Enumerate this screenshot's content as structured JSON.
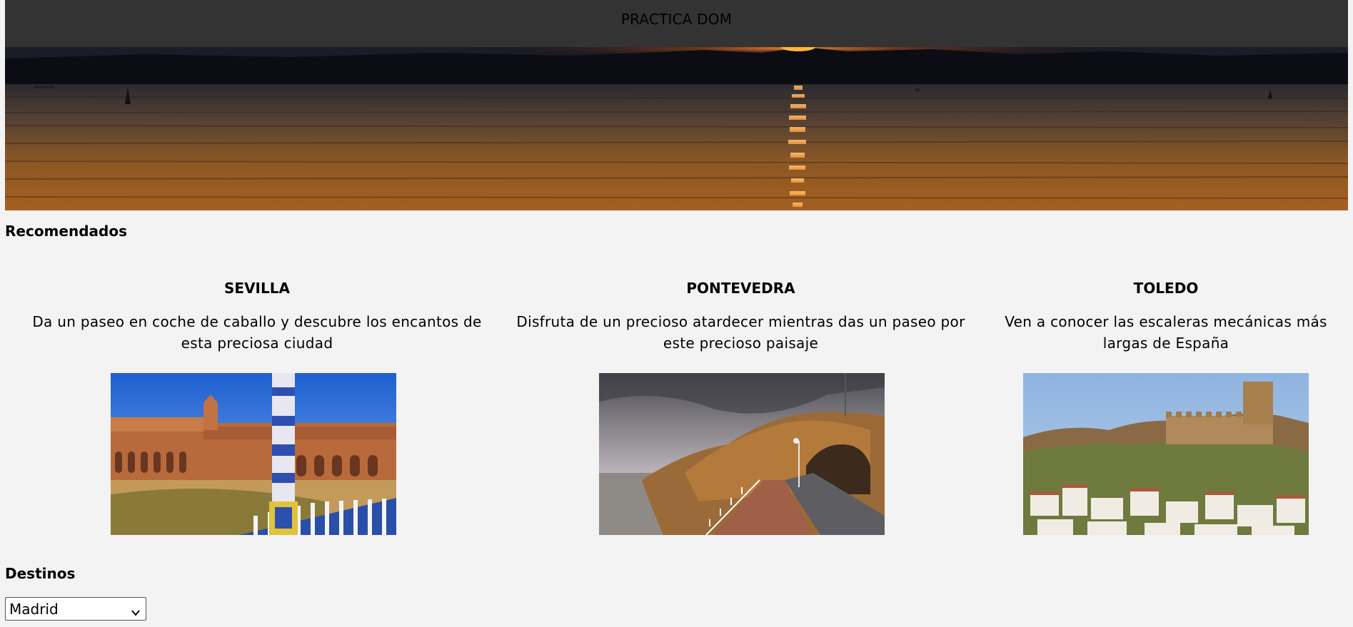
{
  "header": {
    "title": "PRACTICA DOM"
  },
  "hero": {
    "description": "sunset-over-sea-banner"
  },
  "recommended": {
    "title": "Recomendados",
    "cards": [
      {
        "city": "SEVILLA",
        "description": "Da un paseo en coche de caballo y descubre los encantos de esta preciosa ciudad",
        "image": "plaza-de-espana-photo"
      },
      {
        "city": "PONTEVEDRA",
        "description": "Disfruta de un precioso atardecer mientras das un paseo por este precioso paisaje",
        "image": "coastal-arch-path-photo"
      },
      {
        "city": "TOLEDO",
        "description": "Ven a conocer las escaleras mecánicas más largas de España",
        "image": "castle-on-hill-photo"
      }
    ]
  },
  "destinations": {
    "title": "Destinos",
    "selected": "Madrid"
  },
  "colors": {
    "header_bg": "#333333",
    "page_bg": "#f3f3f3"
  }
}
